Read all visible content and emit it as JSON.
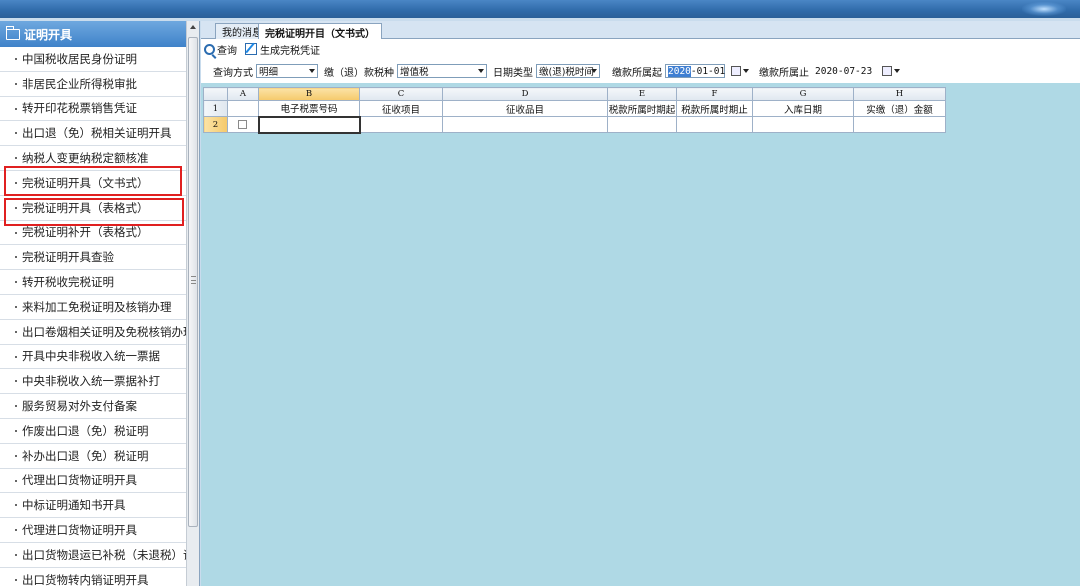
{
  "sidebar": {
    "header": "证明开具",
    "items": [
      "中国税收居民身份证明",
      "非居民企业所得税审批",
      "转开印花税票销售凭证",
      "出口退（免）税相关证明开具",
      "纳税人变更纳税定额核准",
      "完税证明开具（文书式）",
      "完税证明开具（表格式）",
      "完税证明补开（表格式）",
      "完税证明开具查验",
      "转开税收完税证明",
      "来料加工免税证明及核销办理",
      "出口卷烟相关证明及免税核销办理",
      "开具中央非税收入统一票据",
      "中央非税收入统一票据补打",
      "服务贸易对外支付备案",
      "作废出口退（免）税证明",
      "补办出口退（免）税证明",
      "代理出口货物证明开具",
      "中标证明通知书开具",
      "代理进口货物证明开具",
      "出口货物退运已补税（未退税）证明",
      "出口货物转内销证明开具"
    ]
  },
  "tabs": [
    "我的消息",
    "完税证明开目（文书式）"
  ],
  "toolbar": {
    "query_label": "查询",
    "generate_label": "生成完税凭证"
  },
  "filters": {
    "query_mode_label": "查询方式",
    "query_mode_value": "明细",
    "tax_type_label": "缴（退）款税种",
    "tax_type_value": "增值税",
    "date_type_label": "日期类型",
    "date_type_value": "缴(退)税时间",
    "period_start_label": "缴款所属起",
    "period_start_sel": "2020",
    "period_start_rest": "-01-01",
    "period_end_label": "缴款所属止",
    "period_end_value": "2020-07-23"
  },
  "grid": {
    "col_letters": [
      "A",
      "B",
      "C",
      "D",
      "E",
      "F",
      "G",
      "H"
    ],
    "row_numbers": [
      "1",
      "2"
    ],
    "headers": [
      "电子税票号码",
      "征收项目",
      "征收品目",
      "税款所属时期起",
      "税款所属时期止",
      "入库日期",
      "实缴（退）金额"
    ]
  }
}
